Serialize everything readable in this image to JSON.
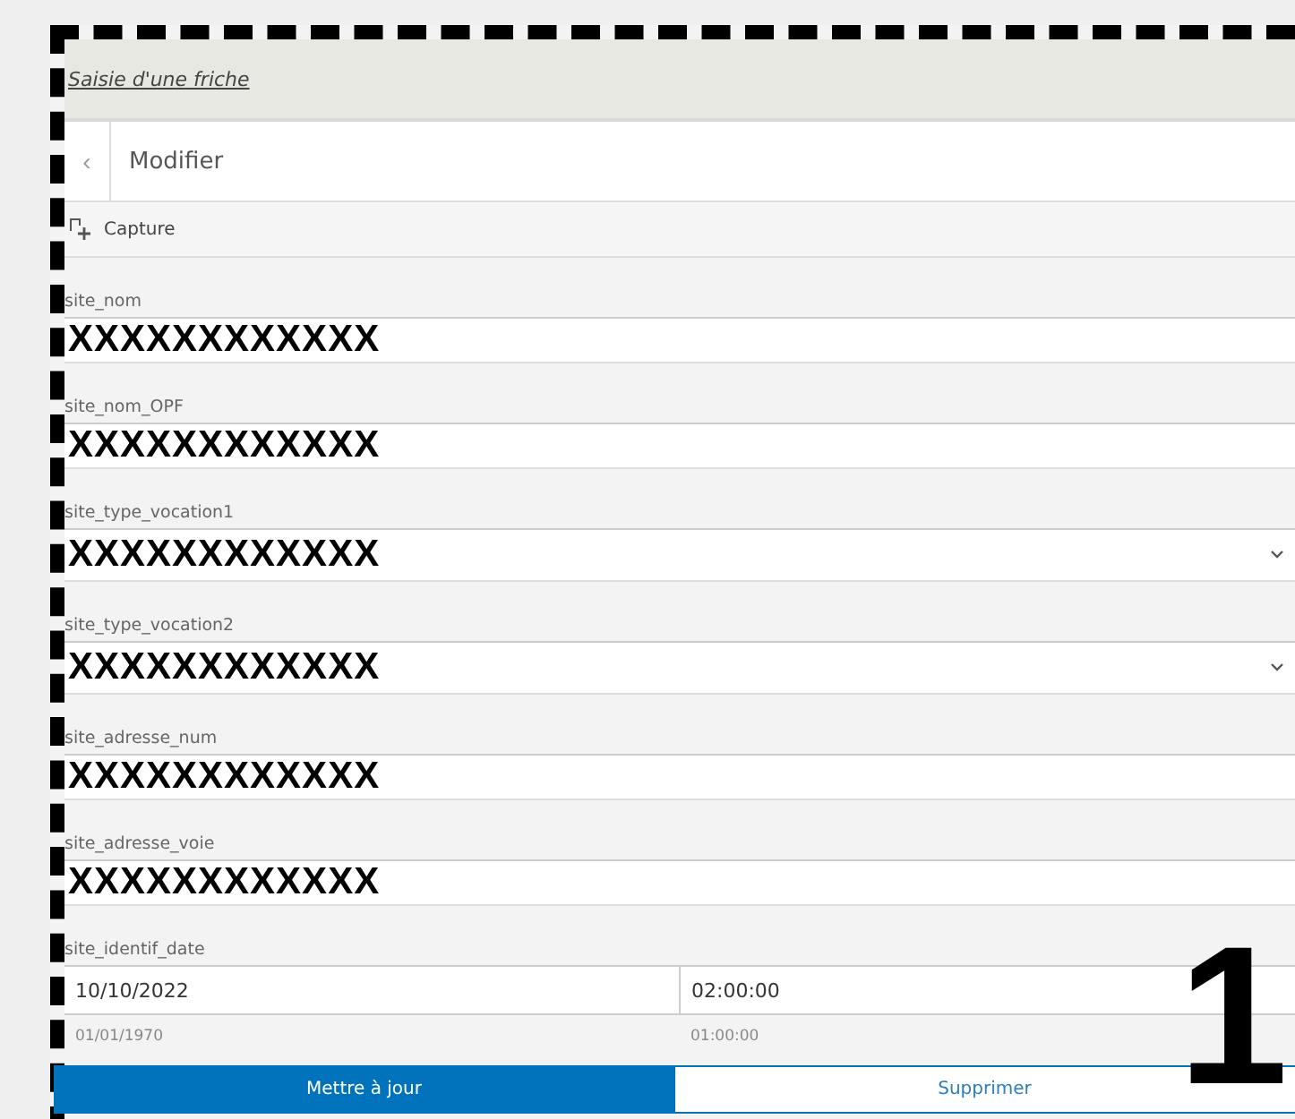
{
  "form_title": "Saisie d'une friche",
  "header": {
    "back": "‹",
    "title": "Modifier"
  },
  "toolbar": {
    "label": "Capture"
  },
  "fields": [
    {
      "kind": "text",
      "label": "site_nom",
      "value": "XXXXXXXXXXXX"
    },
    {
      "kind": "text",
      "label": "site_nom_OPF",
      "value": "XXXXXXXXXXXX"
    },
    {
      "kind": "select",
      "label": "site_type_vocation1",
      "value": "XXXXXXXXXXXX"
    },
    {
      "kind": "select",
      "label": "site_type_vocation2",
      "value": "XXXXXXXXXXXX"
    },
    {
      "kind": "text",
      "label": "site_adresse_num",
      "value": "XXXXXXXXXXXX"
    },
    {
      "kind": "text",
      "label": "site_adresse_voie",
      "value": "XXXXXXXXXXXX"
    },
    {
      "kind": "datetime",
      "label": "site_identif_date",
      "date": "10/10/2022",
      "time": "02:00:00",
      "date_hint": "01/01/1970",
      "time_hint": "01:00:00"
    }
  ],
  "buttons": [
    {
      "label": "Mettre à jour",
      "kind": "primary"
    },
    {
      "label": "Supprimer",
      "kind": "secondary"
    }
  ],
  "annotation": "1"
}
